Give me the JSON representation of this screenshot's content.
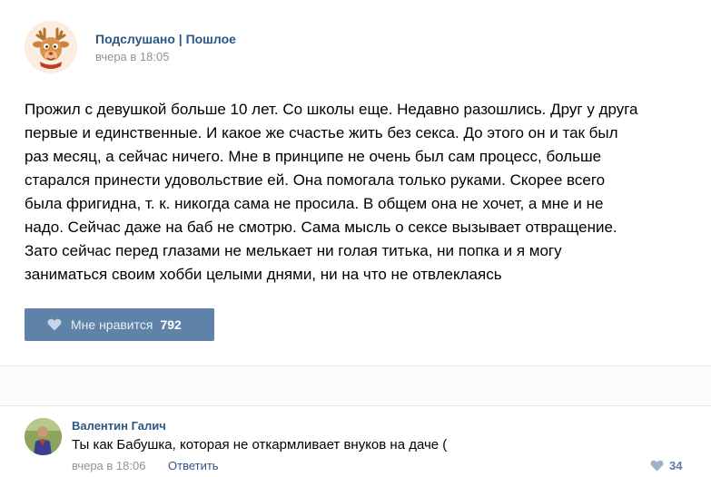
{
  "post": {
    "author": "Подслушано | Пошлое",
    "date": "вчера в 18:05",
    "text_lines": [
      "Прожил с девушкой больше 10 лет. Со школы еще. Недавно разошлись. Друг у друга",
      "первые и единственные. И какое же счастье жить без секса. До этого он и так был",
      "раз месяц, а сейчас ничего. Мне в принципе не очень был сам процесс, больше",
      "старался принести удовольствие ей. Она помогала только руками. Скорее всего",
      "была фригидна, т. к. никогда сама не просила. В общем она не хочет, а мне и не",
      "надо. Сейчас даже на баб не смотрю. Сама мысль о сексе вызывает отвращение.",
      "Зато сейчас перед глазами не мелькает ни голая титька, ни попка и я могу",
      "заниматься своим хобби целыми днями, ни на что не отвлеклаясь"
    ],
    "like_label": "Мне нравится",
    "like_count": "792"
  },
  "comment": {
    "author": "Валентин Галич",
    "text": "Ты как Бабушка, которая не откармливает внуков на даче (",
    "date": "вчера в 18:06",
    "reply_label": "Ответить",
    "like_count": "34"
  },
  "icons": {
    "post_like": "heart-icon",
    "comment_like": "heart-icon"
  },
  "colors": {
    "link": "#2a5885",
    "like_button": "#5e82a8",
    "meta": "#939393"
  }
}
